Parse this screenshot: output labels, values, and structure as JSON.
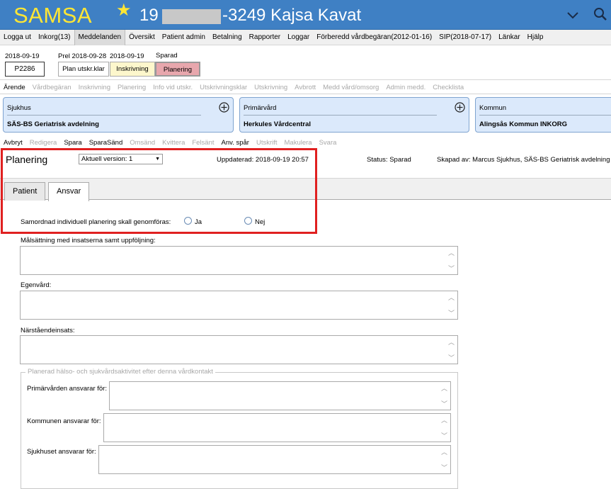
{
  "header": {
    "logo": "SAMSA",
    "patient_number_prefix": "19",
    "patient_number_suffix": "-3249",
    "patient_name": "Kajsa Kavat",
    "colors": {
      "header_bg": "#3f80c4",
      "logo": "#ffe634"
    }
  },
  "menu": {
    "items": [
      "Logga ut",
      "Inkorg(13)",
      "Meddelanden",
      "Översikt",
      "Patient admin",
      "Betalning",
      "Rapporter",
      "Loggar",
      "Förberedd vårdbegäran(2012-01-16)",
      "SIP(2018-07-17)",
      "Länkar",
      "Hjälp"
    ],
    "active": "Meddelanden"
  },
  "status_row": {
    "id_date": "2018-09-19",
    "id": "P2286",
    "steps": [
      {
        "date": "Prel 2018-09-28",
        "label": "Plan utskr.klar",
        "color": "#ffffff"
      },
      {
        "date": "2018-09-19",
        "label": "Inskrivning",
        "color": "#fdf7cc"
      },
      {
        "date": "Sparad",
        "label": "Planering",
        "color": "#e8a7ad"
      }
    ]
  },
  "stepnav": {
    "items": [
      {
        "label": "Ärende",
        "enabled": true
      },
      {
        "label": "Vårdbegäran",
        "enabled": false
      },
      {
        "label": "Inskrivning",
        "enabled": false
      },
      {
        "label": "Planering",
        "enabled": false
      },
      {
        "label": "Info vid utskr.",
        "enabled": false
      },
      {
        "label": "Utskrivningsklar",
        "enabled": false
      },
      {
        "label": "Utskrivning",
        "enabled": false
      },
      {
        "label": "Avbrott",
        "enabled": false
      },
      {
        "label": "Medd vård/omsorg",
        "enabled": false
      },
      {
        "label": "Admin medd.",
        "enabled": false
      },
      {
        "label": "Checklista",
        "enabled": false
      }
    ]
  },
  "cards": [
    {
      "title": "Sjukhus",
      "value": "SÄS-BS Geriatrisk avdelning"
    },
    {
      "title": "Primärvård",
      "value": "Herkules Vårdcentral"
    },
    {
      "title": "Kommun",
      "value": "Alingsås Kommun INKORG"
    }
  ],
  "actions": {
    "items": [
      {
        "label": "Avbryt",
        "enabled": true
      },
      {
        "label": "Redigera",
        "enabled": false
      },
      {
        "label": "Spara",
        "enabled": true
      },
      {
        "label": "SparaSänd",
        "enabled": true
      },
      {
        "label": "Omsänd",
        "enabled": false
      },
      {
        "label": "Kvittera",
        "enabled": false
      },
      {
        "label": "Felsänt",
        "enabled": false
      },
      {
        "label": "Anv. spår",
        "enabled": true
      },
      {
        "label": "Utskrift",
        "enabled": false
      },
      {
        "label": "Makulera",
        "enabled": false
      },
      {
        "label": "Svara",
        "enabled": false
      }
    ]
  },
  "document": {
    "title": "Planering",
    "version": "Aktuell version: 1",
    "updated": "Uppdaterad: 2018-09-19 20:57",
    "status": "Status: Sparad",
    "created_by": "Skapad av: Marcus Sjukhus, SÄS-BS Geriatrisk avdelning"
  },
  "tabs": [
    {
      "label": "Patient",
      "active": false
    },
    {
      "label": "Ansvar",
      "active": true
    }
  ],
  "form": {
    "question": "Samordnad individuell planering skall genomföras:",
    "options": [
      "Ja",
      "Nej"
    ],
    "fields": [
      {
        "label": "Målsättning med insatserna samt uppföljning:",
        "value": ""
      },
      {
        "label": "Egenvård:",
        "value": ""
      },
      {
        "label": "Närståendeinsats:",
        "value": ""
      }
    ],
    "fieldset": {
      "legend": "Planerad hälso- och sjukvårdsaktivitet efter denna vårdkontakt",
      "fields": [
        {
          "label": "Primärvården ansvarar för:",
          "value": ""
        },
        {
          "label": "Kommunen ansvarar för:",
          "value": ""
        },
        {
          "label": "Sjukhuset ansvarar för:",
          "value": ""
        }
      ]
    }
  }
}
